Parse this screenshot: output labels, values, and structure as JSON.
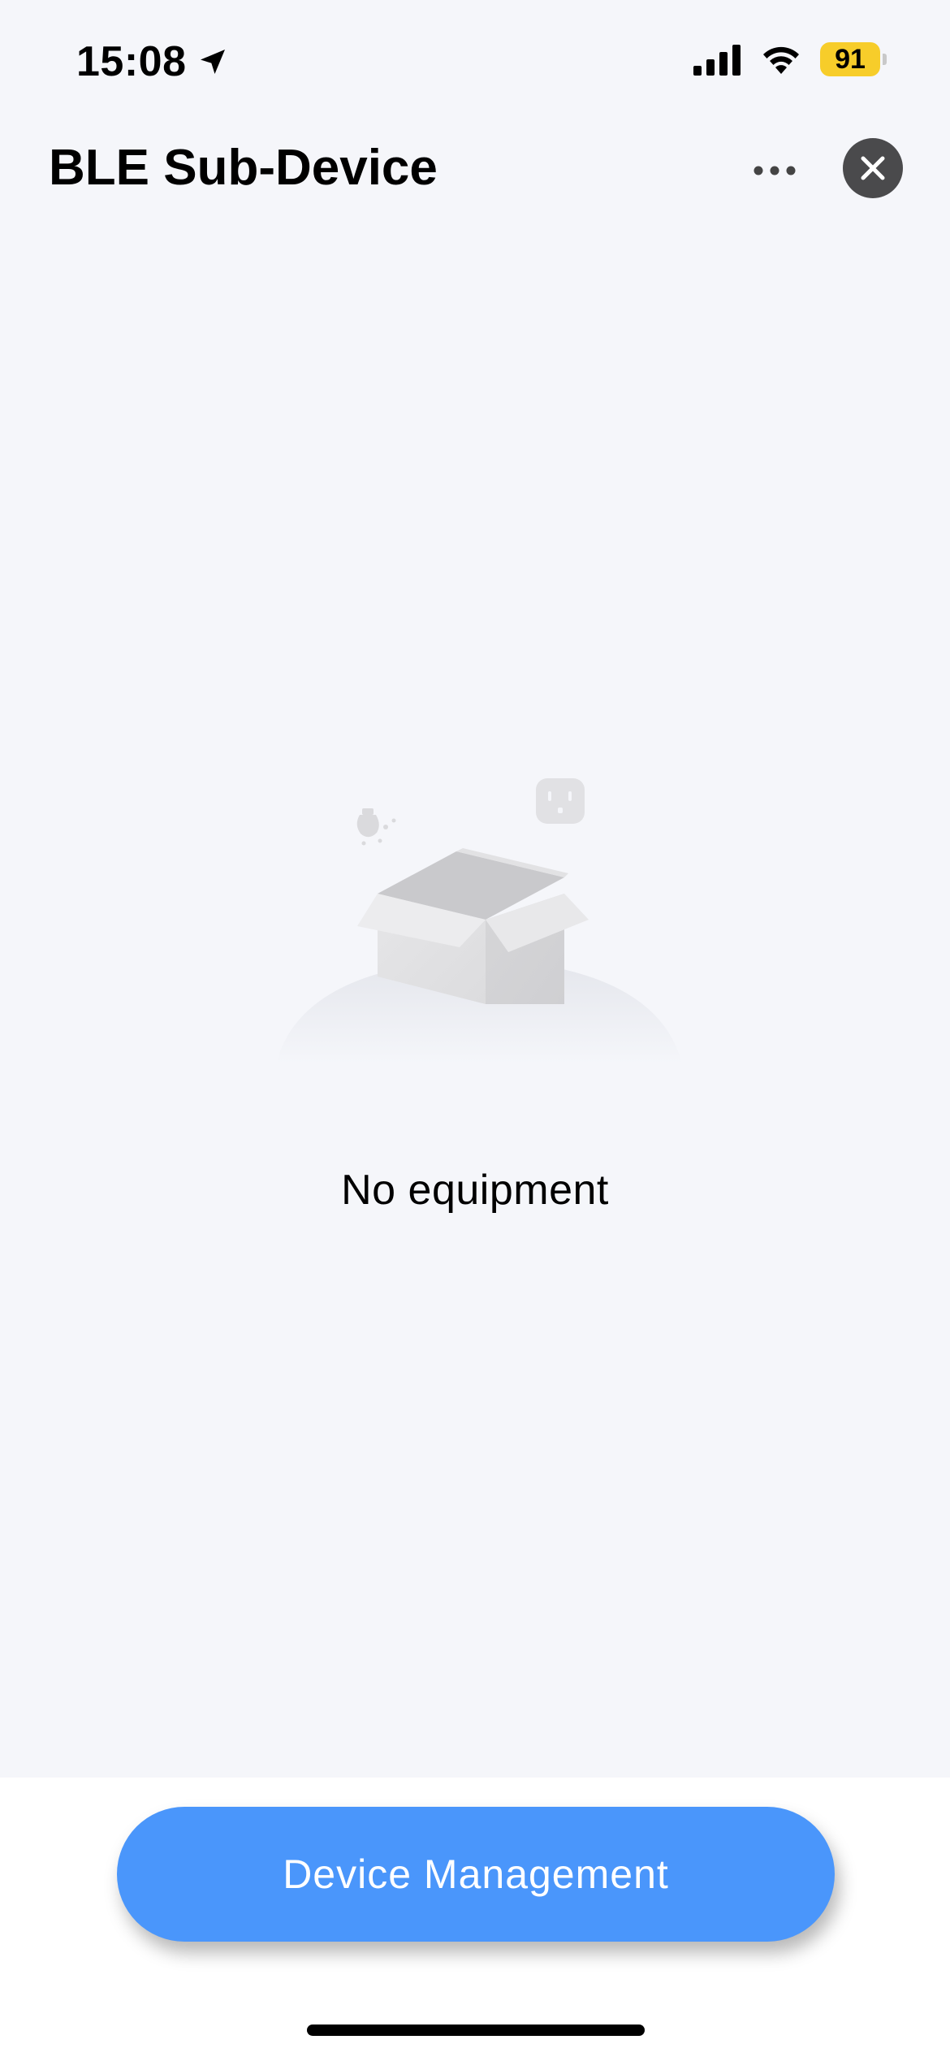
{
  "status_bar": {
    "time": "15:08",
    "battery_level": "91",
    "icons": [
      "location-arrow-icon",
      "cellular-signal-icon",
      "wifi-icon",
      "battery-icon"
    ],
    "battery_color": "#f7cd2a"
  },
  "header": {
    "title": "BLE Sub-Device",
    "more_icon": "more-dots-icon",
    "close_icon": "close-icon"
  },
  "empty_state": {
    "illustration": "empty-box-illustration",
    "message": "No equipment"
  },
  "footer": {
    "button_label": "Device Management",
    "button_color": "#4a96fb"
  }
}
